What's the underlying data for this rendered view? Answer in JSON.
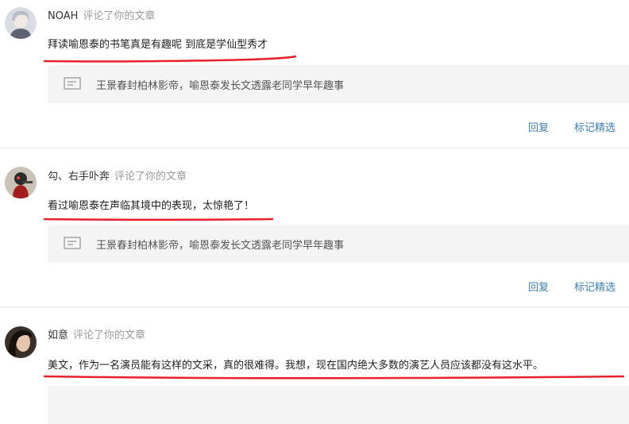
{
  "comments": [
    {
      "user": "NOAH",
      "action": "评论了你的文章",
      "text": "拜读喻恩泰的书笔真是有趣呢 到底是学仙型秀才",
      "article": "王景春封柏林影帝，喻恩泰发长文透露老同学早年趣事",
      "reply_label": "回复",
      "feature_label": "标记精选"
    },
    {
      "user": "勾、右手卟奔",
      "action": "评论了你的文章",
      "text": "看过喻恩泰在声临其境中的表现，太惊艳了！",
      "article": "王景春封柏林影帝，喻恩泰发长文透露老同学早年趣事",
      "reply_label": "回复",
      "feature_label": "标记精选"
    },
    {
      "user": "如意",
      "action": "评论了你的文章",
      "text": "美文，作为一名演员能有这样的文采，真的很难得。我想，现在国内绝大多数的演艺人员应该都没有这水平。"
    }
  ],
  "colors": {
    "accent_link": "#3d7fb8",
    "annotation_underline": "#e8202a",
    "muted_text": "#9a9a9a",
    "reference_bg": "#f4f4f4"
  },
  "icons": {
    "article_reference": "article-icon"
  }
}
